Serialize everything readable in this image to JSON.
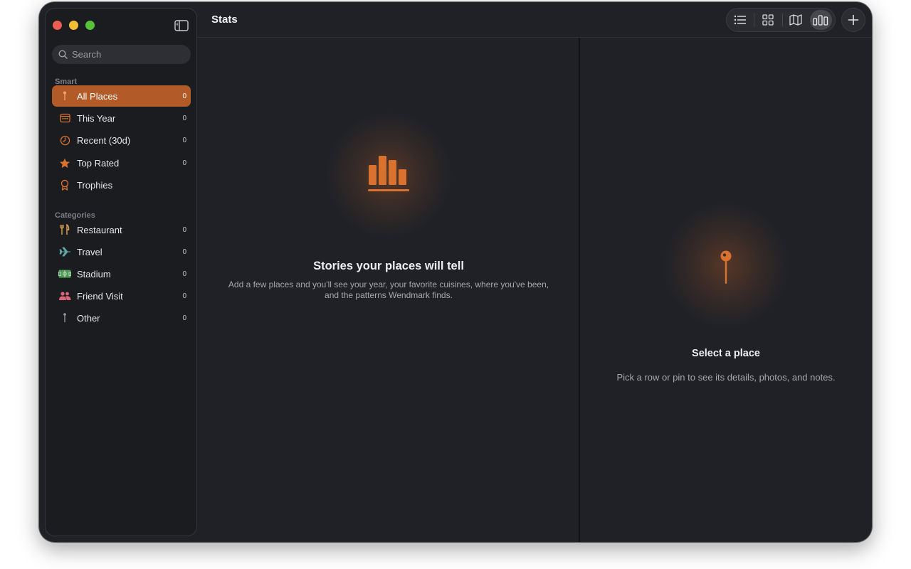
{
  "window": {
    "title": "Stats"
  },
  "sidebar": {
    "search_placeholder": "Search",
    "smart_label": "Smart",
    "smart_items": [
      {
        "label": "All Places",
        "count": "0",
        "icon": "pin-icon",
        "active": true
      },
      {
        "label": "This Year",
        "count": "0",
        "icon": "calendar-icon"
      },
      {
        "label": "Recent (30d)",
        "count": "0",
        "icon": "clock-icon"
      },
      {
        "label": "Top Rated",
        "count": "0",
        "icon": "star-icon"
      },
      {
        "label": "Trophies",
        "count": "",
        "icon": "award-icon"
      }
    ],
    "categories_label": "Categories",
    "category_items": [
      {
        "label": "Restaurant",
        "count": "0",
        "icon": "fork-knife-icon"
      },
      {
        "label": "Travel",
        "count": "0",
        "icon": "airplane-icon"
      },
      {
        "label": "Stadium",
        "count": "0",
        "icon": "stadium-icon"
      },
      {
        "label": "Friend Visit",
        "count": "0",
        "icon": "people-icon"
      },
      {
        "label": "Other",
        "count": "0",
        "icon": "pin-icon"
      }
    ]
  },
  "toolbar": {
    "views": [
      "list-view-icon",
      "grid-view-icon",
      "map-view-icon",
      "stats-view-icon"
    ],
    "active_view": "stats-view-icon",
    "add_icon": "plus-icon"
  },
  "stats_panel": {
    "icon": "bar-chart-icon",
    "title": "Stories your places will tell",
    "subtitle_line1": "Add a few places and you'll see your year, your favorite cuisines, where you've been,",
    "subtitle_line2": "and the patterns Wendmark finds."
  },
  "detail_panel": {
    "icon": "pin-icon",
    "title": "Select a place",
    "subtitle": "Pick a row or pin to see its details, photos, and notes."
  },
  "colors": {
    "accent": "#b25a28",
    "icon_orange": "#d9722f",
    "window_bg": "#1f2127",
    "sidebar_bg": "#1b1c20"
  }
}
